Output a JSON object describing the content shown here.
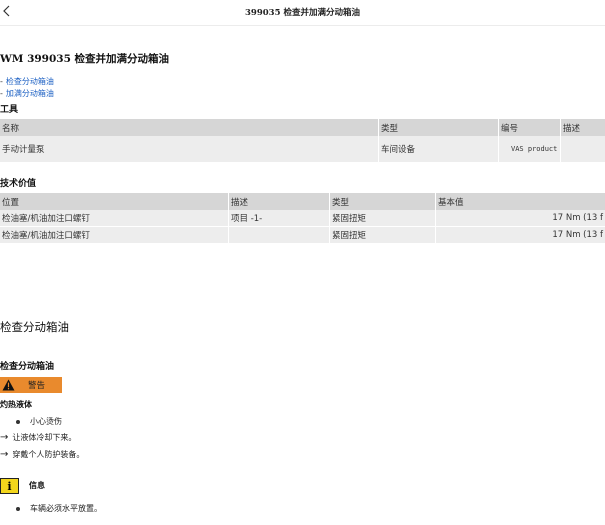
{
  "header": {
    "title": "399035 检查并加满分动箱油"
  },
  "doc_title": "WM 399035 检查并加满分动箱油",
  "links": [
    {
      "dash": "-",
      "label": "检查分动箱油"
    },
    {
      "dash": "-",
      "label": "加满分动箱油"
    }
  ],
  "tools": {
    "heading": "工具",
    "columns": [
      "名称",
      "类型",
      "编号",
      "描述"
    ],
    "rows": [
      {
        "name": "手动计量泵",
        "type": "车间设备",
        "number": "VAS product",
        "desc": ""
      }
    ]
  },
  "tech_values": {
    "heading": "技术价值",
    "columns": [
      "位置",
      "描述",
      "类型",
      "基本值"
    ],
    "rows": [
      {
        "position": "检油塞/机油加注口螺钉",
        "desc": "项目 -1-",
        "type": "紧固扭矩",
        "value": "17 Nm (13 f"
      },
      {
        "position": "检油塞/机油加注口螺钉",
        "desc": "",
        "type": "紧固扭矩",
        "value": "17 Nm (13 f"
      }
    ]
  },
  "section": {
    "title": "检查分动箱油",
    "subtitle": "检查分动箱油",
    "warning_label": "警告",
    "hot_fluid": "灼热液体",
    "bullet": "小心烫伤",
    "steps": [
      "让液体冷却下来。",
      "穿戴个人防护装备。"
    ],
    "arrow": "→",
    "info_glyph": "i",
    "info_label": "信息",
    "info_bullet": "车辆必须水平放置。"
  }
}
